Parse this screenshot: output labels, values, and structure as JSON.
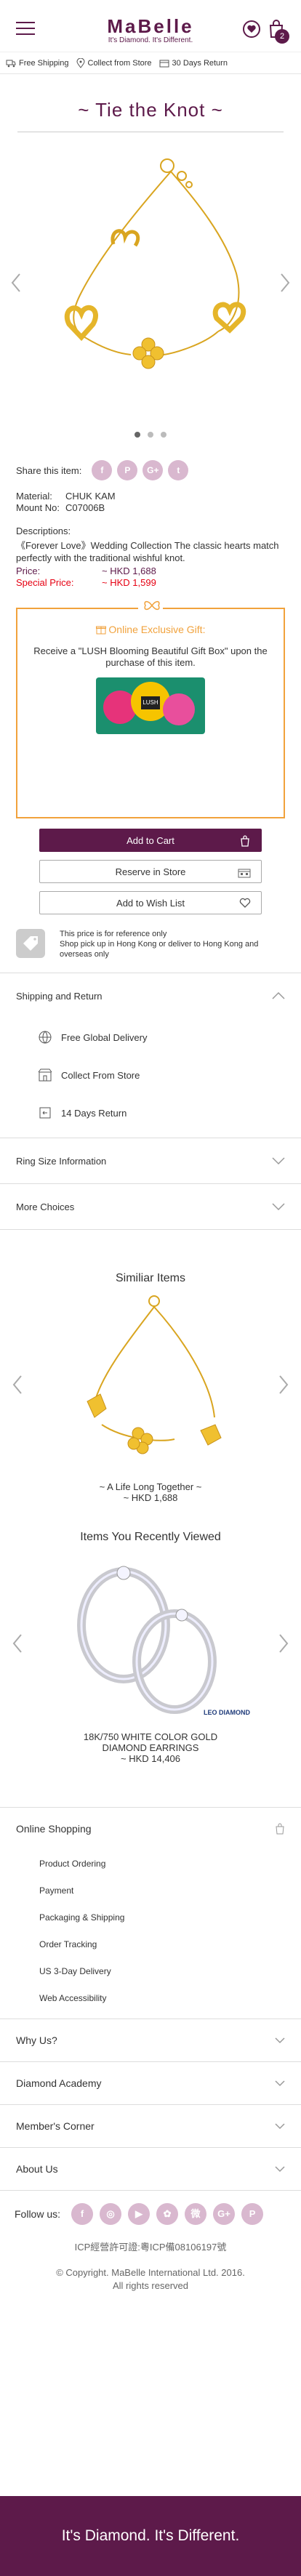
{
  "header": {
    "logo": "MaBelle",
    "tagline": "It's Diamond. It's Different.",
    "cart_count": "2"
  },
  "servicebar": {
    "items": [
      "Free Shipping",
      "Collect from Store",
      "30 Days Return"
    ]
  },
  "product": {
    "collection_title": "~ Tie the Knot ~",
    "share_label": "Share this item:",
    "share_icons": [
      "f",
      "P",
      "G+",
      "t"
    ],
    "material_label": "Material:",
    "material_value": "CHUK KAM",
    "mount_label": "Mount No:",
    "mount_value": "C07006B",
    "desc_label": "Descriptions:",
    "description": "《Forever Love》Wedding Collection The classic hearts match perfectly with the traditional wishful knot.",
    "price_label": "Price:",
    "price_value": "~ HKD 1,688",
    "special_label": "Special Price:",
    "special_value": "~ HKD 1,599"
  },
  "gift": {
    "title": "Online Exclusive Gift:",
    "text": "Receive a \"LUSH Blooming Beautiful Gift Box\" upon the purchase of this item."
  },
  "actions": {
    "add_to_cart": "Add to Cart",
    "reserve": "Reserve in Store",
    "wishlist": "Add to Wish List"
  },
  "notice": {
    "line1": "This price is for reference only",
    "line2": "Shop pick up in Hong Kong or deliver to Hong Kong and overseas only"
  },
  "shipping": {
    "title": "Shipping and Return",
    "items": [
      "Free Global Delivery",
      "Collect From Store",
      "14 Days Return"
    ]
  },
  "ring_size": "Ring Size Information",
  "more_choices": "More Choices",
  "similar": {
    "title": "Similiar Items",
    "name": "~ A Life Long Together ~",
    "price": "~ HKD 1,688"
  },
  "recent": {
    "title": "Items You Recently Viewed",
    "brand": "LEO DIAMOND",
    "name": "18K/750 WHITE COLOR GOLD DIAMOND EARRINGS",
    "price": "~ HKD 14,406"
  },
  "footer": {
    "online_shopping": "Online Shopping",
    "links": [
      "Product Ordering",
      "Payment",
      "Packaging & Shipping",
      "Order Tracking",
      "US 3-Day Delivery",
      "Web Accessibility"
    ],
    "why_us": "Why Us?",
    "academy": "Diamond Academy",
    "member": "Member's Corner",
    "about": "About Us",
    "follow": "Follow us:",
    "follow_icons": [
      "f",
      "◎",
      "▶",
      "✿",
      "微",
      "G+",
      "P"
    ],
    "icp": "ICP經營許可證:粵ICP備08106197號",
    "copyright1": "© Copyright. MaBelle International Ltd. 2016.",
    "copyright2": "All rights reserved",
    "bottom_tagline": "It's Diamond. It's Different."
  }
}
